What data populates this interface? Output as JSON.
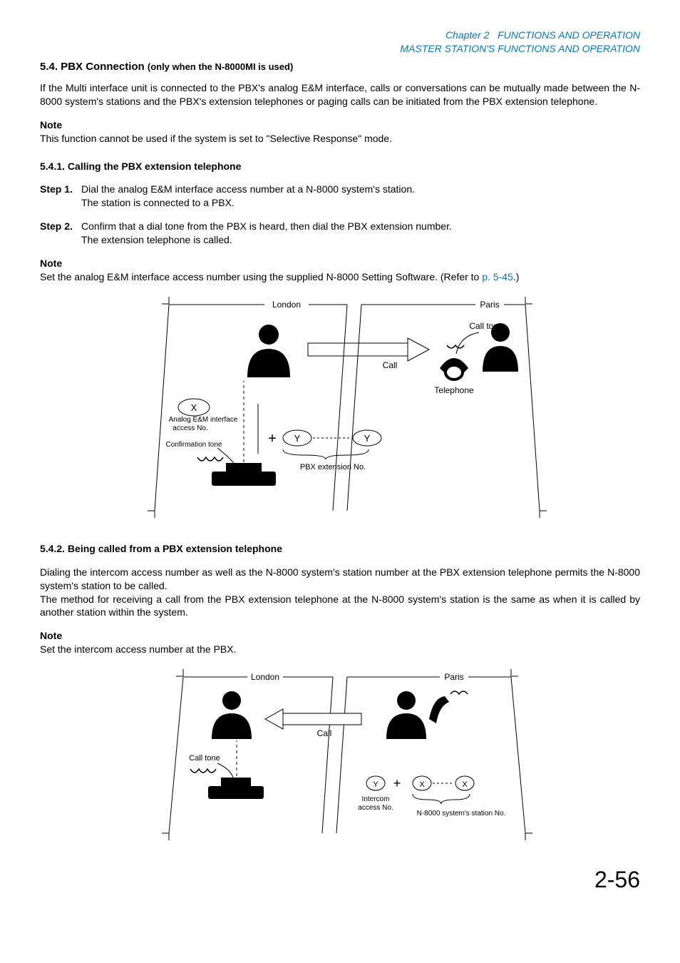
{
  "header": {
    "chapter": "Chapter 2",
    "title1": "FUNCTIONS AND OPERATION",
    "title2": "MASTER STATION'S FUNCTIONS AND OPERATION"
  },
  "section": {
    "num": "5.4. PBX Connection ",
    "sub": "(only when the N-8000MI is used)",
    "intro": "If the Multi interface unit is connected to the PBX's analog E&M interface, calls or conversations can be mutually made between the N-8000 system's stations and the PBX's extension telephones or paging calls can be initiated from the PBX extension telephone.",
    "note1_head": "Note",
    "note1_body": "This function cannot be used if the system is set to \"Selective Response\" mode."
  },
  "s541": {
    "title": "5.4.1. Calling the PBX extension telephone",
    "step1_label": "Step 1.",
    "step1_l1": "Dial the analog E&M interface access number at a N-8000 system's station.",
    "step1_l2": "The station is connected to a PBX.",
    "step2_label": "Step 2.",
    "step2_l1": "Confirm that a dial tone from the PBX is heard, then dial the PBX extension number.",
    "step2_l2": "The extension telephone is called.",
    "note_head": "Note",
    "note_body_a": "Set the analog E&M interface access number using the supplied N-8000 Setting Software. (Refer to ",
    "note_link": "p. 5-45",
    "note_body_b": ".)"
  },
  "dia1": {
    "london": "London",
    "paris": "Paris",
    "calltone": "Call tone",
    "call": "Call",
    "telephone": "Telephone",
    "x": "X",
    "y": "Y",
    "analog_l1": "Analog E&M interface",
    "analog_l2": "access No.",
    "conf": "Confirmation tone",
    "pbx_ext": "PBX extension No.",
    "plus": "+"
  },
  "s542": {
    "title": "5.4.2. Being called from a PBX extension telephone",
    "p1": "Dialing the intercom access number as well as the N-8000 system's station number at the PBX extension telephone permits the N-8000 system's station to be called.",
    "p2": "The method for receiving a call from the PBX extension telephone at the N-8000 system's station is the same as when it is called by another station within the system.",
    "note_head": "Note",
    "note_body": "Set the intercom access number at the PBX."
  },
  "dia2": {
    "london": "London",
    "paris": "Paris",
    "call": "Call",
    "calltone": "Call tone",
    "y": "Y",
    "x": "X",
    "plus": "+",
    "intercom_l1": "Intercom",
    "intercom_l2": "access No.",
    "station_no": "N-8000 system's station No."
  },
  "page": "2-56"
}
